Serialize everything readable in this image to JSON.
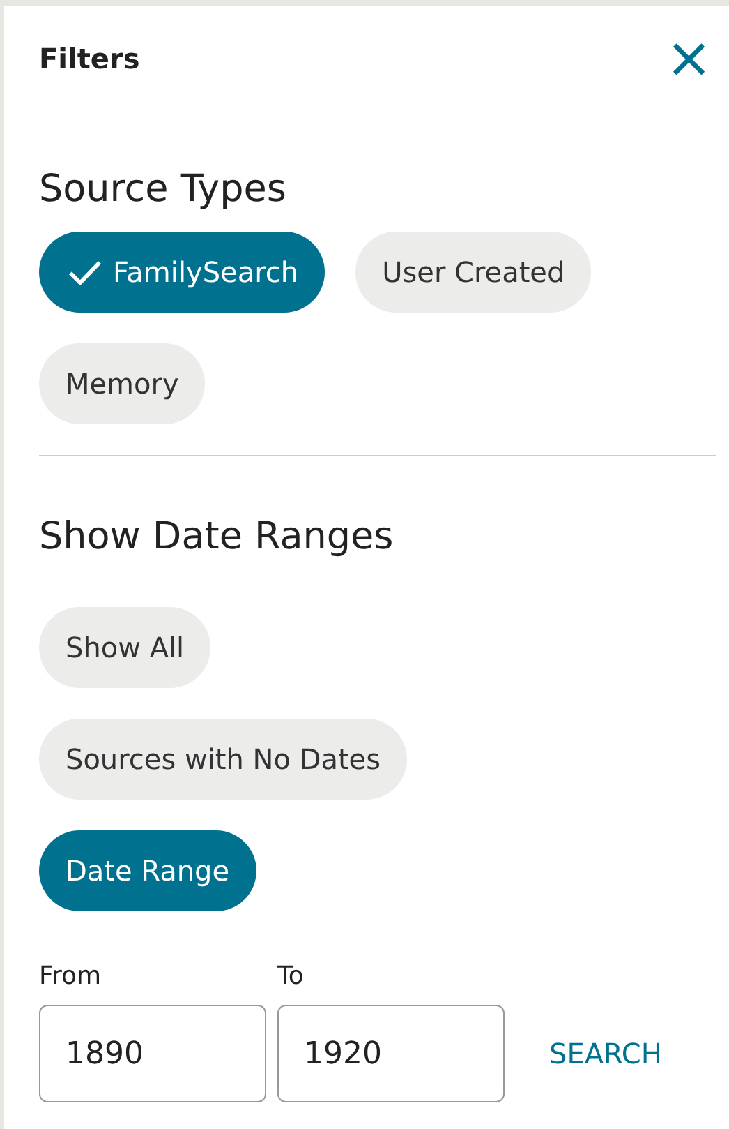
{
  "header": {
    "title": "Filters",
    "close": "×"
  },
  "source_types": {
    "heading": "Source Types",
    "chips": [
      {
        "label": "FamilySearch",
        "selected": true
      },
      {
        "label": "User Created",
        "selected": false
      },
      {
        "label": "Memory",
        "selected": false
      }
    ]
  },
  "date_ranges": {
    "heading": "Show Date Ranges",
    "chips": [
      {
        "label": "Show All",
        "selected": false
      },
      {
        "label": "Sources with No Dates",
        "selected": false
      },
      {
        "label": "Date Range",
        "selected": true
      }
    ]
  },
  "range": {
    "fields": [
      {
        "label": "From",
        "value": "1890"
      },
      {
        "label": "To",
        "value": "1920"
      }
    ],
    "search": "SEARCH"
  }
}
